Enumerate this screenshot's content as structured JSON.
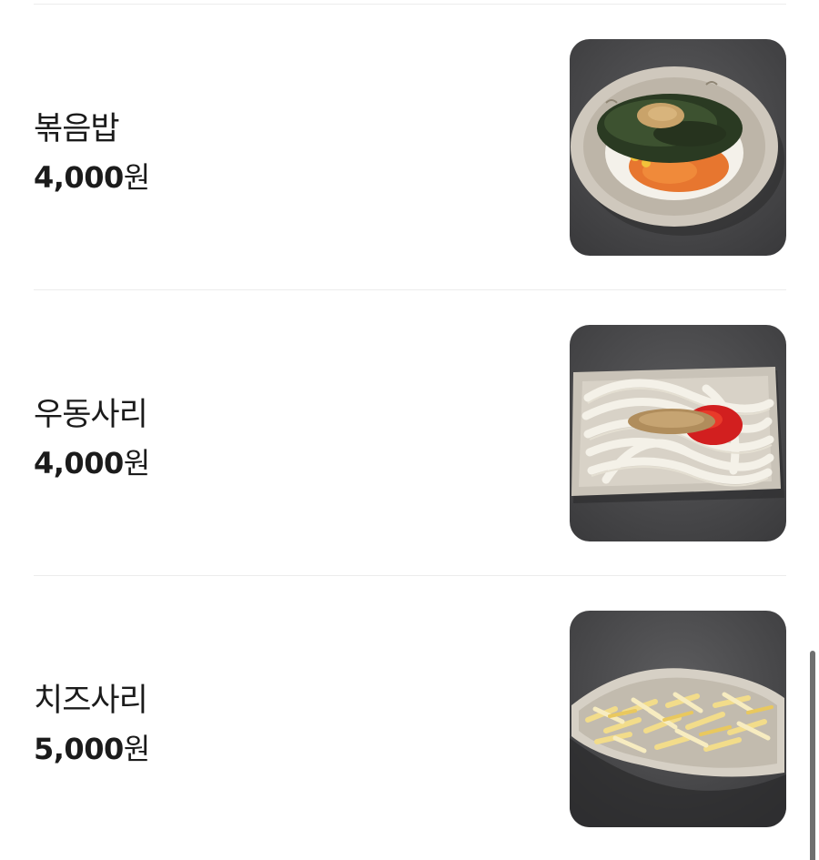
{
  "menu": {
    "items": [
      {
        "name": "볶음밥",
        "price": "4,000",
        "currency": "원",
        "image_icon": "fried-rice-dish-icon"
      },
      {
        "name": "우동사리",
        "price": "4,000",
        "currency": "원",
        "image_icon": "udon-noodles-dish-icon"
      },
      {
        "name": "치즈사리",
        "price": "5,000",
        "currency": "원",
        "image_icon": "shredded-cheese-dish-icon"
      }
    ]
  },
  "colors": {
    "text": "#1b1b1b",
    "divider": "#ececec",
    "photo_background": "#4a4a4c",
    "scrollbar": "#6f6f6f"
  }
}
